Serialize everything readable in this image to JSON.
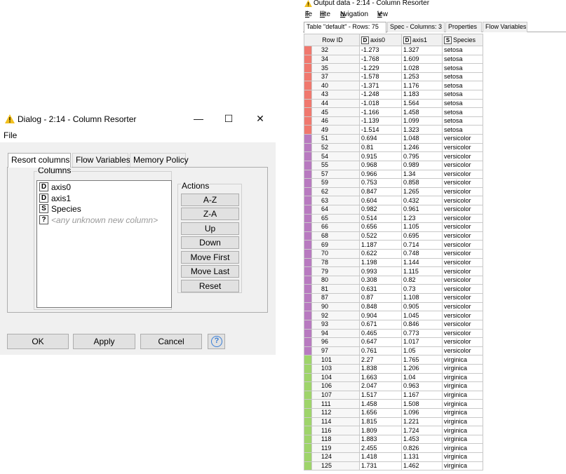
{
  "dialog": {
    "title": "Dialog - 2:14 - Column Resorter",
    "menu": {
      "file": "File"
    },
    "window_controls": {
      "minimize": "—",
      "maximize": "☐",
      "close": "✕"
    },
    "tabs": [
      "Resort columns",
      "Flow Variables",
      "Memory Policy"
    ],
    "columns_group_label": "Columns",
    "column_list": [
      {
        "type": "D",
        "name": "axis0"
      },
      {
        "type": "D",
        "name": "axis1"
      },
      {
        "type": "S",
        "name": "Species"
      },
      {
        "type": "?",
        "name": "<any unknown new column>"
      }
    ],
    "actions_label": "Actions",
    "actions": [
      "A-Z",
      "Z-A",
      "Up",
      "Down",
      "Move First",
      "Move Last",
      "Reset"
    ],
    "buttons": {
      "ok": "OK",
      "apply": "Apply",
      "cancel": "Cancel",
      "help": "?"
    }
  },
  "output": {
    "title": "Output data - 2:14 - Column Resorter",
    "menu": {
      "file": {
        "mn": "F",
        "rest": "ile"
      },
      "hilite": {
        "mn": "H",
        "rest": "ilite"
      },
      "navigation": {
        "mn": "N",
        "rest": "avigation"
      },
      "view": {
        "mn": "V",
        "rest": "iew"
      }
    },
    "tabs": [
      "Table \"default\" - Rows: 75",
      "Spec - Columns: 3",
      "Properties",
      "Flow Variables"
    ],
    "header": {
      "rowid": "Row ID",
      "c0_type": "D",
      "c0": "axis0",
      "c1_type": "D",
      "c1": "axis1",
      "c2_type": "S",
      "c2": "Species"
    },
    "colors": {
      "setosa": "#f0786e",
      "versicolor": "#b87ac0",
      "virginica": "#9ed46a"
    },
    "rows": [
      [
        "32",
        "-1.273",
        "1.327",
        "setosa"
      ],
      [
        "34",
        "-1.768",
        "1.609",
        "setosa"
      ],
      [
        "35",
        "-1.229",
        "1.028",
        "setosa"
      ],
      [
        "37",
        "-1.578",
        "1.253",
        "setosa"
      ],
      [
        "40",
        "-1.371",
        "1.176",
        "setosa"
      ],
      [
        "43",
        "-1.248",
        "1.183",
        "setosa"
      ],
      [
        "44",
        "-1.018",
        "1.564",
        "setosa"
      ],
      [
        "45",
        "-1.166",
        "1.458",
        "setosa"
      ],
      [
        "46",
        "-1.139",
        "1.099",
        "setosa"
      ],
      [
        "49",
        "-1.514",
        "1.323",
        "setosa"
      ],
      [
        "51",
        "0.694",
        "1.048",
        "versicolor"
      ],
      [
        "52",
        "0.81",
        "1.246",
        "versicolor"
      ],
      [
        "54",
        "0.915",
        "0.795",
        "versicolor"
      ],
      [
        "55",
        "0.968",
        "0.989",
        "versicolor"
      ],
      [
        "57",
        "0.966",
        "1.34",
        "versicolor"
      ],
      [
        "59",
        "0.753",
        "0.858",
        "versicolor"
      ],
      [
        "62",
        "0.847",
        "1.265",
        "versicolor"
      ],
      [
        "63",
        "0.604",
        "0.432",
        "versicolor"
      ],
      [
        "64",
        "0.982",
        "0.961",
        "versicolor"
      ],
      [
        "65",
        "0.514",
        "1.23",
        "versicolor"
      ],
      [
        "66",
        "0.656",
        "1.105",
        "versicolor"
      ],
      [
        "68",
        "0.522",
        "0.695",
        "versicolor"
      ],
      [
        "69",
        "1.187",
        "0.714",
        "versicolor"
      ],
      [
        "70",
        "0.622",
        "0.748",
        "versicolor"
      ],
      [
        "78",
        "1.198",
        "1.144",
        "versicolor"
      ],
      [
        "79",
        "0.993",
        "1.115",
        "versicolor"
      ],
      [
        "80",
        "0.308",
        "0.82",
        "versicolor"
      ],
      [
        "81",
        "0.631",
        "0.73",
        "versicolor"
      ],
      [
        "87",
        "0.87",
        "1.108",
        "versicolor"
      ],
      [
        "90",
        "0.848",
        "0.905",
        "versicolor"
      ],
      [
        "92",
        "0.904",
        "1.045",
        "versicolor"
      ],
      [
        "93",
        "0.671",
        "0.846",
        "versicolor"
      ],
      [
        "94",
        "0.465",
        "0.773",
        "versicolor"
      ],
      [
        "96",
        "0.647",
        "1.017",
        "versicolor"
      ],
      [
        "97",
        "0.761",
        "1.05",
        "versicolor"
      ],
      [
        "101",
        "2.27",
        "1.765",
        "virginica"
      ],
      [
        "103",
        "1.838",
        "1.206",
        "virginica"
      ],
      [
        "104",
        "1.663",
        "1.04",
        "virginica"
      ],
      [
        "106",
        "2.047",
        "0.963",
        "virginica"
      ],
      [
        "107",
        "1.517",
        "1.167",
        "virginica"
      ],
      [
        "111",
        "1.458",
        "1.508",
        "virginica"
      ],
      [
        "112",
        "1.656",
        "1.096",
        "virginica"
      ],
      [
        "114",
        "1.815",
        "1.221",
        "virginica"
      ],
      [
        "116",
        "1.809",
        "1.724",
        "virginica"
      ],
      [
        "118",
        "1.883",
        "1.453",
        "virginica"
      ],
      [
        "119",
        "2.455",
        "0.826",
        "virginica"
      ],
      [
        "124",
        "1.418",
        "1.131",
        "virginica"
      ],
      [
        "125",
        "1.731",
        "1.462",
        "virginica"
      ]
    ]
  }
}
